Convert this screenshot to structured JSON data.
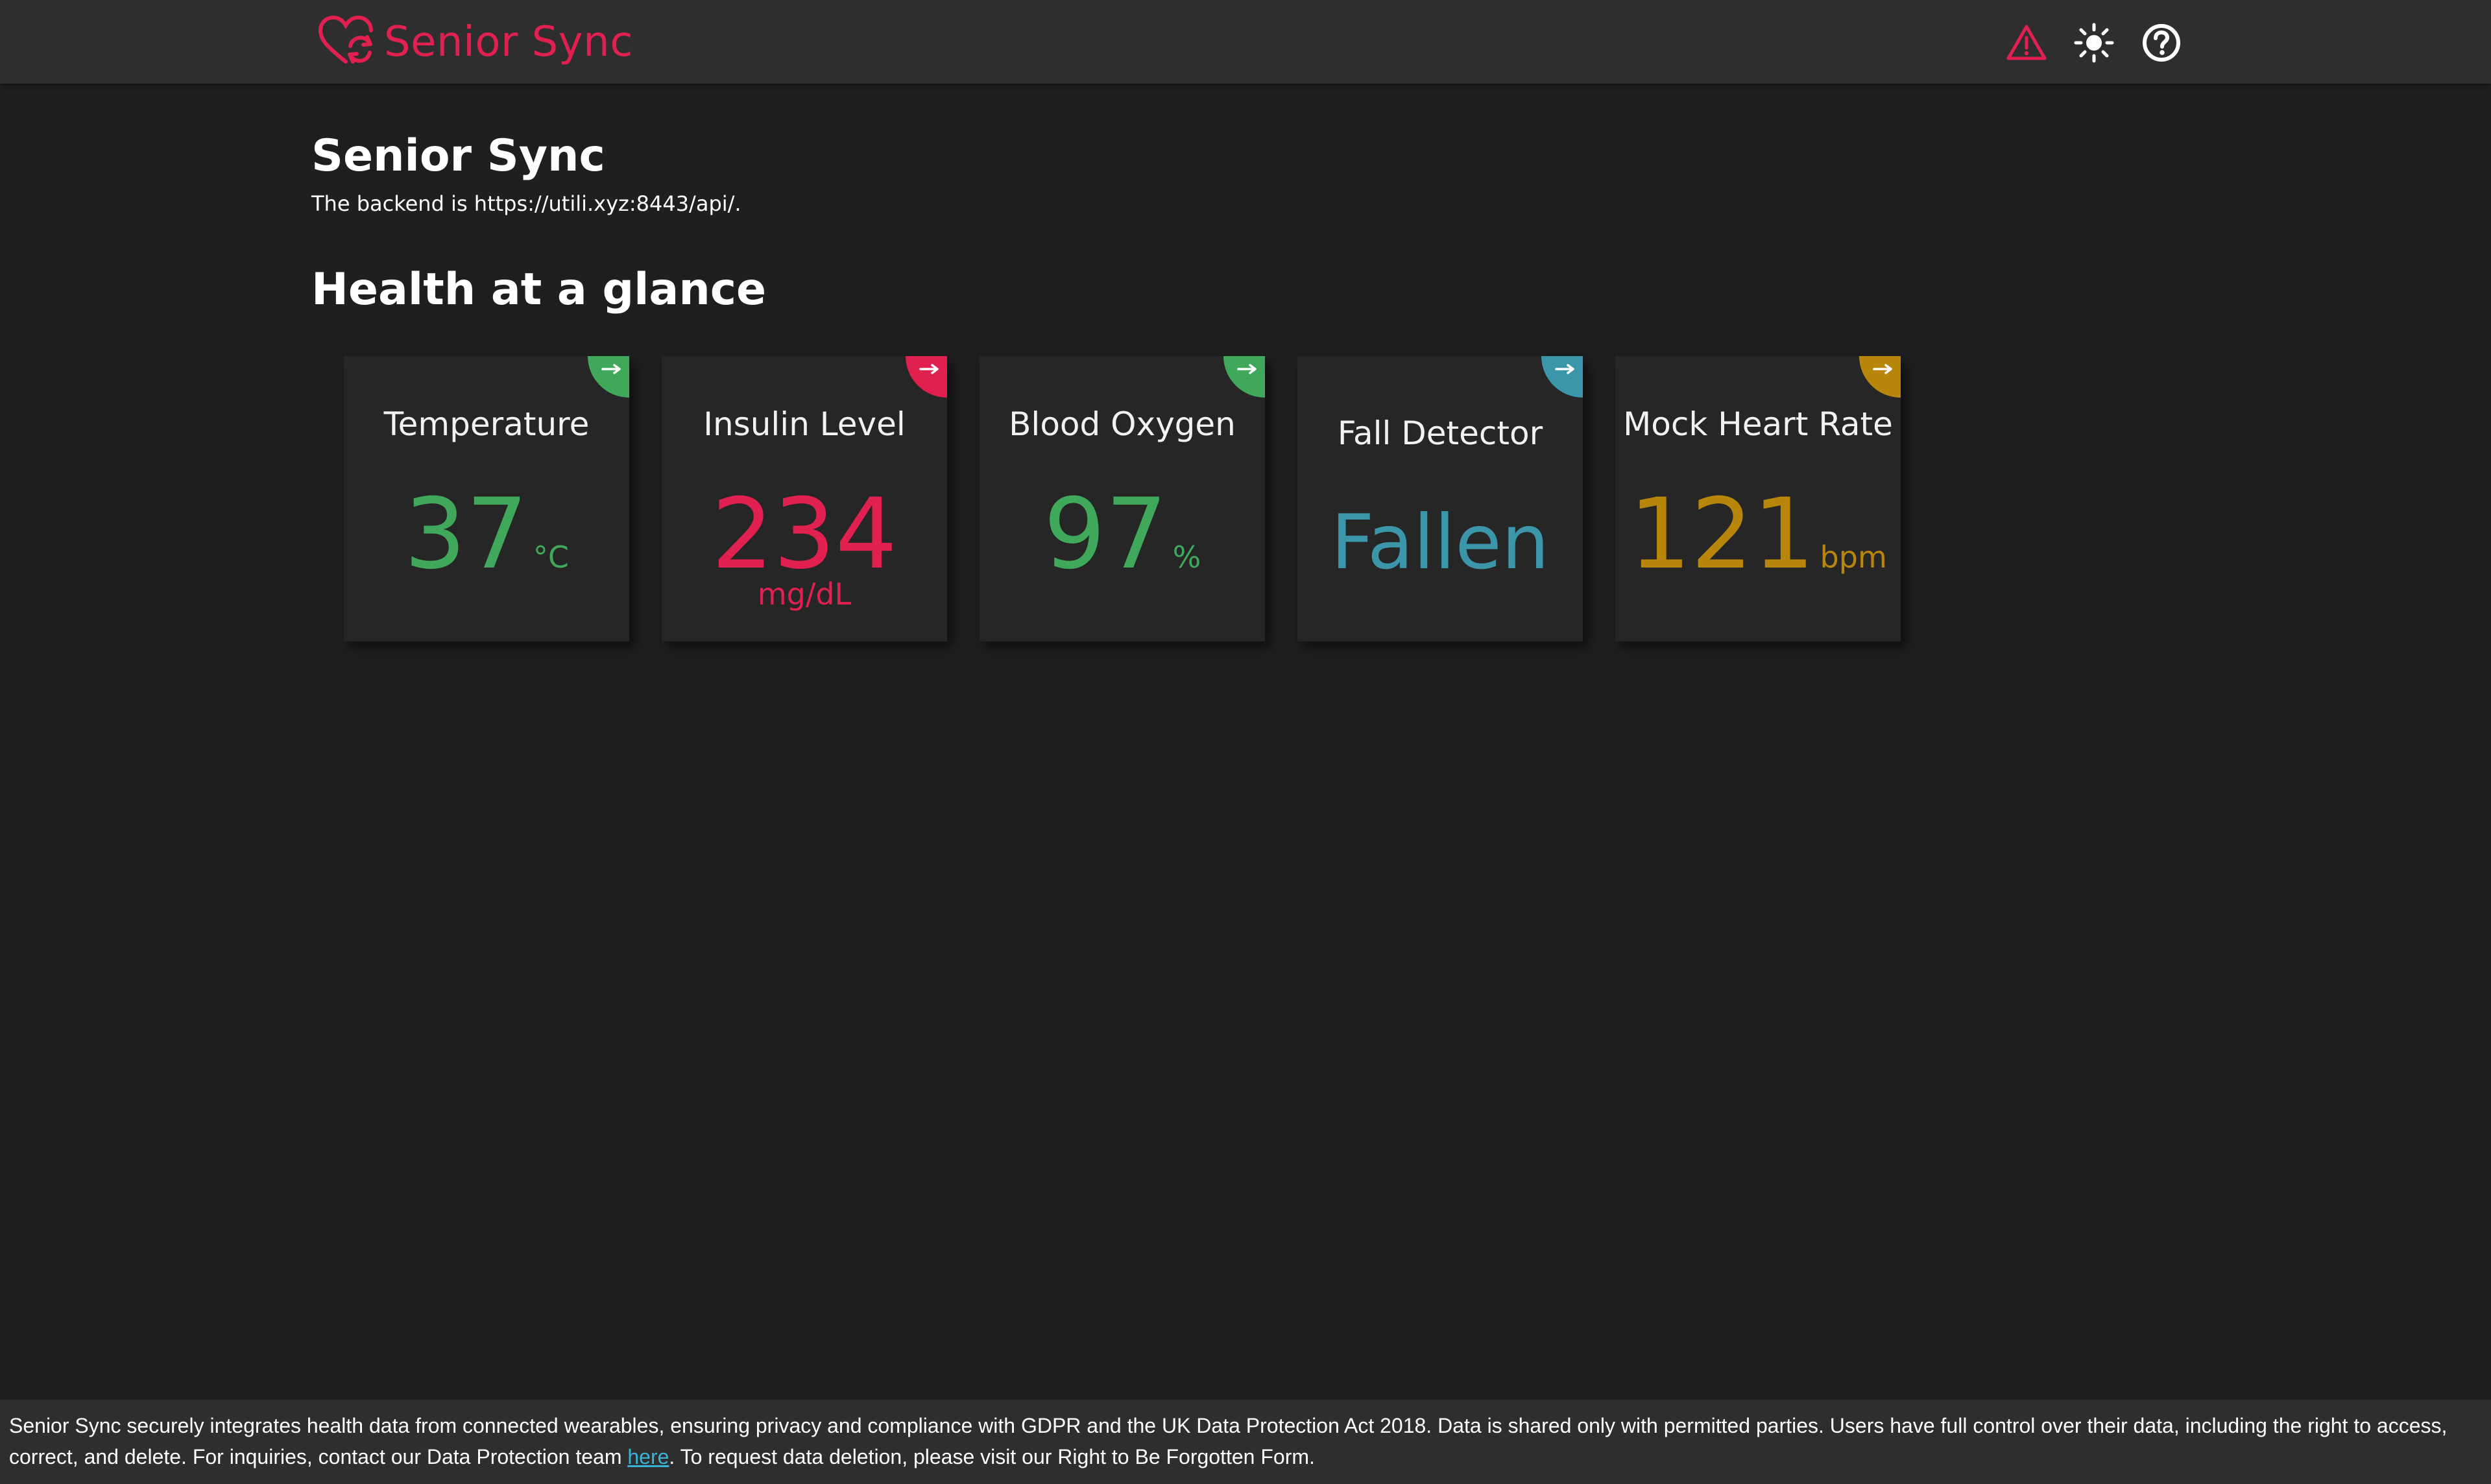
{
  "header": {
    "brand": "Senior Sync",
    "icons": [
      "heart-sync-icon",
      "alert-triangle-icon",
      "sun-icon",
      "help-circle-icon"
    ]
  },
  "main": {
    "title": "Senior Sync",
    "backend_text": "The backend is https://utili.xyz:8443/api/.",
    "section_title": "Health at a glance"
  },
  "cards": [
    {
      "label": "Temperature",
      "value": "37",
      "unit": "°C",
      "color": "#3fa85a",
      "icon": "arrow-right-icon"
    },
    {
      "label": "Insulin Level",
      "value": "234",
      "unit": "mg/dL",
      "color": "#e0204f",
      "icon": "arrow-right-icon"
    },
    {
      "label": "Blood Oxygen",
      "value": "97",
      "unit": "%",
      "color": "#3fa85a",
      "icon": "arrow-right-icon"
    },
    {
      "label": "Fall Detector",
      "value": "Fallen",
      "unit": "",
      "color": "#3a96a8",
      "icon": "arrow-right-icon"
    },
    {
      "label": "Mock Heart Rate",
      "value": "121",
      "unit": "bpm",
      "color": "#b8860b",
      "icon": "arrow-right-icon"
    }
  ],
  "footer": {
    "text_before": "Senior Sync securely integrates health data from connected wearables, ensuring privacy and compliance with GDPR and the UK Data Protection Act 2018. Data is shared only with permitted parties. Users have full control over their data, including the right to access, correct, and delete. For inquiries, contact our Data Protection team ",
    "link_text": "here",
    "text_after": ". To request data deletion, please visit our Right to Be Forgotten Form."
  },
  "colors": {
    "brand": "#e0204f",
    "background": "#1f1f1f",
    "header_bg": "#2e2e2e",
    "card_bg": "#262626",
    "link": "#3ab4d6"
  }
}
